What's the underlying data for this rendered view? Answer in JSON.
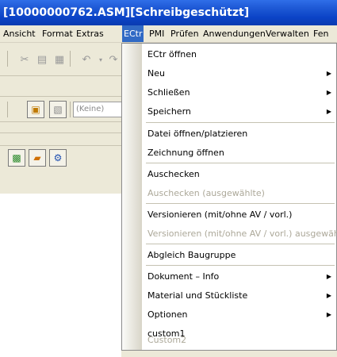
{
  "window": {
    "title": "[10000000762.ASM][Schreibgeschützt]"
  },
  "menubar": {
    "items": [
      "Ansicht",
      "Format",
      "Extras",
      "ECtr",
      "PMI",
      "Prüfen",
      "Anwendungen",
      "Verwalten",
      "Fen"
    ],
    "active": "ECtr"
  },
  "toolbar": {
    "dropdown_value": "(Keine)"
  },
  "context_menu": {
    "items": [
      {
        "label": "ECtr öffnen",
        "enabled": true,
        "submenu": false
      },
      {
        "label": "Neu",
        "enabled": true,
        "submenu": true
      },
      {
        "label": "Schließen",
        "enabled": true,
        "submenu": true
      },
      {
        "label": "Speichern",
        "enabled": true,
        "submenu": true
      },
      {
        "label": "Datei öffnen/platzieren",
        "enabled": true,
        "submenu": false
      },
      {
        "label": "Zeichnung öffnen",
        "enabled": true,
        "submenu": false
      },
      {
        "label": "Auschecken",
        "enabled": true,
        "submenu": false
      },
      {
        "label": "Auschecken (ausgewählte)",
        "enabled": false,
        "submenu": false
      },
      {
        "label": "Versionieren (mit/ohne AV / vorl.)",
        "enabled": true,
        "submenu": false
      },
      {
        "label": "Versionieren (mit/ohne AV / vorl.) ausgewählte",
        "enabled": false,
        "submenu": false
      },
      {
        "label": "Abgleich Baugruppe",
        "enabled": true,
        "submenu": false
      },
      {
        "label": "Dokument – Info",
        "enabled": true,
        "submenu": true
      },
      {
        "label": "Material und Stückliste",
        "enabled": true,
        "submenu": true
      },
      {
        "label": "Optionen",
        "enabled": true,
        "submenu": true
      },
      {
        "label": "custom1",
        "enabled": true,
        "submenu": false
      },
      {
        "label": "Custom2",
        "enabled": false,
        "submenu": false
      }
    ],
    "submenu_arrow": "▶"
  },
  "icons": {
    "cut": "scissors-icon",
    "copy": "copy-icon",
    "paste": "paste-icon",
    "undo": "undo-icon",
    "redo": "redo-icon"
  },
  "colors": {
    "title_bar": "#0b43c6",
    "menu_highlight": "#316ac5",
    "disabled_text": "#aca899",
    "chrome": "#ece9d8"
  }
}
